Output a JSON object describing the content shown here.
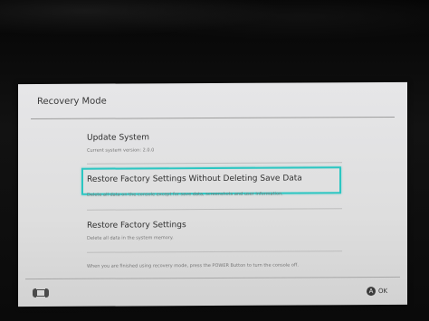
{
  "header": {
    "title": "Recovery Mode"
  },
  "options": [
    {
      "title": "Update System",
      "description": "Current system version: 2.0.0"
    },
    {
      "title": "Restore Factory Settings Without Deleting Save Data",
      "description": "Delete all data on the console except for save data, screenshots and user information."
    },
    {
      "title": "Restore Factory Settings",
      "description": "Delete all data in the system memory."
    }
  ],
  "footer": {
    "instruction": "When you are finished using recovery mode, press the POWER Button to turn the console off.",
    "ok_label": "OK",
    "a_button_glyph": "A"
  },
  "icons": {
    "console": "console-icon",
    "a_button": "a-button-icon"
  },
  "colors": {
    "selection": "#2cc6c2",
    "screen_bg": "#e6e6e8",
    "text": "#2f2f2f"
  }
}
